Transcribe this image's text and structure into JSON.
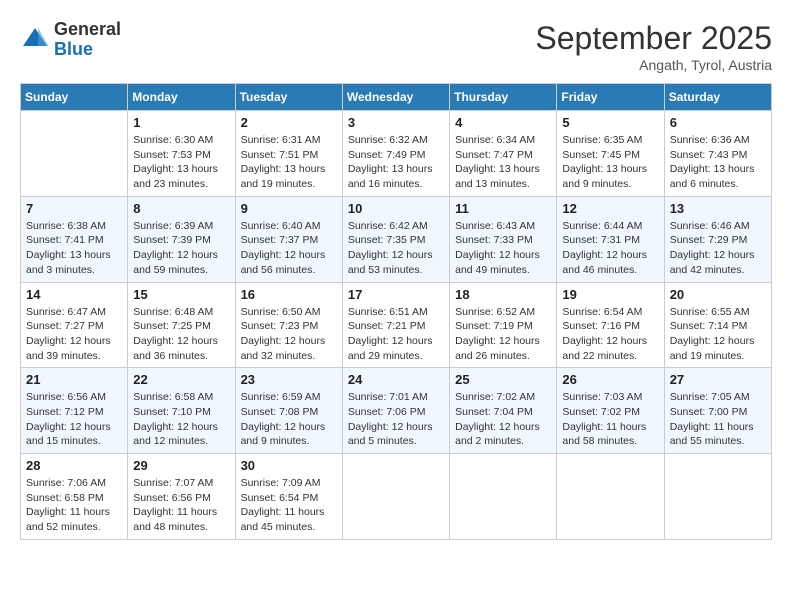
{
  "header": {
    "logo_general": "General",
    "logo_blue": "Blue",
    "month_title": "September 2025",
    "location": "Angath, Tyrol, Austria"
  },
  "days_of_week": [
    "Sunday",
    "Monday",
    "Tuesday",
    "Wednesday",
    "Thursday",
    "Friday",
    "Saturday"
  ],
  "weeks": [
    [
      {
        "day": null
      },
      {
        "day": 1,
        "sunrise": "Sunrise: 6:30 AM",
        "sunset": "Sunset: 7:53 PM",
        "daylight": "Daylight: 13 hours and 23 minutes."
      },
      {
        "day": 2,
        "sunrise": "Sunrise: 6:31 AM",
        "sunset": "Sunset: 7:51 PM",
        "daylight": "Daylight: 13 hours and 19 minutes."
      },
      {
        "day": 3,
        "sunrise": "Sunrise: 6:32 AM",
        "sunset": "Sunset: 7:49 PM",
        "daylight": "Daylight: 13 hours and 16 minutes."
      },
      {
        "day": 4,
        "sunrise": "Sunrise: 6:34 AM",
        "sunset": "Sunset: 7:47 PM",
        "daylight": "Daylight: 13 hours and 13 minutes."
      },
      {
        "day": 5,
        "sunrise": "Sunrise: 6:35 AM",
        "sunset": "Sunset: 7:45 PM",
        "daylight": "Daylight: 13 hours and 9 minutes."
      },
      {
        "day": 6,
        "sunrise": "Sunrise: 6:36 AM",
        "sunset": "Sunset: 7:43 PM",
        "daylight": "Daylight: 13 hours and 6 minutes."
      }
    ],
    [
      {
        "day": 7,
        "sunrise": "Sunrise: 6:38 AM",
        "sunset": "Sunset: 7:41 PM",
        "daylight": "Daylight: 13 hours and 3 minutes."
      },
      {
        "day": 8,
        "sunrise": "Sunrise: 6:39 AM",
        "sunset": "Sunset: 7:39 PM",
        "daylight": "Daylight: 12 hours and 59 minutes."
      },
      {
        "day": 9,
        "sunrise": "Sunrise: 6:40 AM",
        "sunset": "Sunset: 7:37 PM",
        "daylight": "Daylight: 12 hours and 56 minutes."
      },
      {
        "day": 10,
        "sunrise": "Sunrise: 6:42 AM",
        "sunset": "Sunset: 7:35 PM",
        "daylight": "Daylight: 12 hours and 53 minutes."
      },
      {
        "day": 11,
        "sunrise": "Sunrise: 6:43 AM",
        "sunset": "Sunset: 7:33 PM",
        "daylight": "Daylight: 12 hours and 49 minutes."
      },
      {
        "day": 12,
        "sunrise": "Sunrise: 6:44 AM",
        "sunset": "Sunset: 7:31 PM",
        "daylight": "Daylight: 12 hours and 46 minutes."
      },
      {
        "day": 13,
        "sunrise": "Sunrise: 6:46 AM",
        "sunset": "Sunset: 7:29 PM",
        "daylight": "Daylight: 12 hours and 42 minutes."
      }
    ],
    [
      {
        "day": 14,
        "sunrise": "Sunrise: 6:47 AM",
        "sunset": "Sunset: 7:27 PM",
        "daylight": "Daylight: 12 hours and 39 minutes."
      },
      {
        "day": 15,
        "sunrise": "Sunrise: 6:48 AM",
        "sunset": "Sunset: 7:25 PM",
        "daylight": "Daylight: 12 hours and 36 minutes."
      },
      {
        "day": 16,
        "sunrise": "Sunrise: 6:50 AM",
        "sunset": "Sunset: 7:23 PM",
        "daylight": "Daylight: 12 hours and 32 minutes."
      },
      {
        "day": 17,
        "sunrise": "Sunrise: 6:51 AM",
        "sunset": "Sunset: 7:21 PM",
        "daylight": "Daylight: 12 hours and 29 minutes."
      },
      {
        "day": 18,
        "sunrise": "Sunrise: 6:52 AM",
        "sunset": "Sunset: 7:19 PM",
        "daylight": "Daylight: 12 hours and 26 minutes."
      },
      {
        "day": 19,
        "sunrise": "Sunrise: 6:54 AM",
        "sunset": "Sunset: 7:16 PM",
        "daylight": "Daylight: 12 hours and 22 minutes."
      },
      {
        "day": 20,
        "sunrise": "Sunrise: 6:55 AM",
        "sunset": "Sunset: 7:14 PM",
        "daylight": "Daylight: 12 hours and 19 minutes."
      }
    ],
    [
      {
        "day": 21,
        "sunrise": "Sunrise: 6:56 AM",
        "sunset": "Sunset: 7:12 PM",
        "daylight": "Daylight: 12 hours and 15 minutes."
      },
      {
        "day": 22,
        "sunrise": "Sunrise: 6:58 AM",
        "sunset": "Sunset: 7:10 PM",
        "daylight": "Daylight: 12 hours and 12 minutes."
      },
      {
        "day": 23,
        "sunrise": "Sunrise: 6:59 AM",
        "sunset": "Sunset: 7:08 PM",
        "daylight": "Daylight: 12 hours and 9 minutes."
      },
      {
        "day": 24,
        "sunrise": "Sunrise: 7:01 AM",
        "sunset": "Sunset: 7:06 PM",
        "daylight": "Daylight: 12 hours and 5 minutes."
      },
      {
        "day": 25,
        "sunrise": "Sunrise: 7:02 AM",
        "sunset": "Sunset: 7:04 PM",
        "daylight": "Daylight: 12 hours and 2 minutes."
      },
      {
        "day": 26,
        "sunrise": "Sunrise: 7:03 AM",
        "sunset": "Sunset: 7:02 PM",
        "daylight": "Daylight: 11 hours and 58 minutes."
      },
      {
        "day": 27,
        "sunrise": "Sunrise: 7:05 AM",
        "sunset": "Sunset: 7:00 PM",
        "daylight": "Daylight: 11 hours and 55 minutes."
      }
    ],
    [
      {
        "day": 28,
        "sunrise": "Sunrise: 7:06 AM",
        "sunset": "Sunset: 6:58 PM",
        "daylight": "Daylight: 11 hours and 52 minutes."
      },
      {
        "day": 29,
        "sunrise": "Sunrise: 7:07 AM",
        "sunset": "Sunset: 6:56 PM",
        "daylight": "Daylight: 11 hours and 48 minutes."
      },
      {
        "day": 30,
        "sunrise": "Sunrise: 7:09 AM",
        "sunset": "Sunset: 6:54 PM",
        "daylight": "Daylight: 11 hours and 45 minutes."
      },
      {
        "day": null
      },
      {
        "day": null
      },
      {
        "day": null
      },
      {
        "day": null
      }
    ]
  ]
}
